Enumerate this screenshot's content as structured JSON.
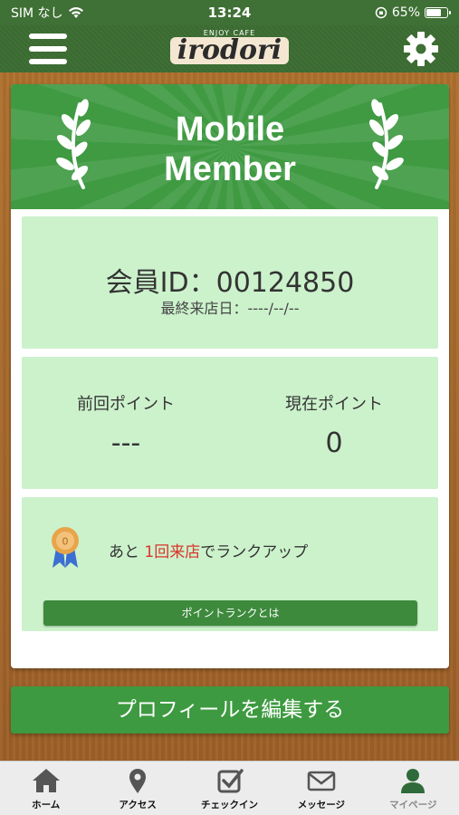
{
  "status_bar": {
    "carrier": "SIM なし",
    "time": "13:24",
    "battery": "65%",
    "battery_level": 0.65
  },
  "header": {
    "logo_text": "irodori",
    "logo_subtext": "ENJOY CAFE"
  },
  "banner": {
    "title_line1": "Mobile",
    "title_line2": "Member"
  },
  "member": {
    "id_text": "会員ID：00124850",
    "last_visit": "最終来店日：----/--/--"
  },
  "points": {
    "previous_label": "前回ポイント",
    "previous_value": "---",
    "current_label": "現在ポイント",
    "current_value": "0"
  },
  "rank": {
    "prefix": "あと",
    "highlight": "1回来店",
    "suffix": "でランクアップ",
    "button_label": "ポイントランクとは",
    "medal_number": "0"
  },
  "profile_button": "プロフィールを編集する",
  "tabs": [
    {
      "label": "ホーム",
      "icon": "home-icon"
    },
    {
      "label": "アクセス",
      "icon": "map-pin-icon"
    },
    {
      "label": "チェックイン",
      "icon": "checkin-icon"
    },
    {
      "label": "メッセージ",
      "icon": "envelope-icon"
    },
    {
      "label": "マイページ",
      "icon": "user-icon"
    }
  ],
  "colors": {
    "header_green": "#3f7035",
    "banner_green": "#3f9a42",
    "panel_green": "#ccf2cc",
    "button_green": "#3d9a40",
    "highlight_red": "#d9342b",
    "wood_brown": "#a8692f"
  }
}
